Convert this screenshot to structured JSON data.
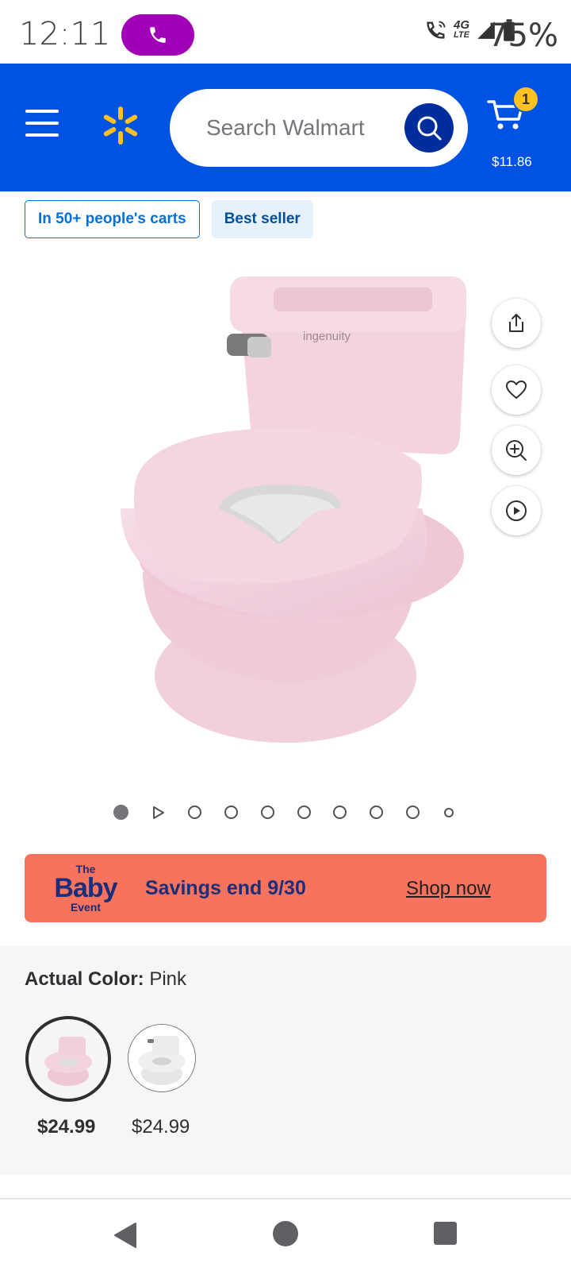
{
  "status_bar": {
    "time": "12:11",
    "network": "4G",
    "network_sub": "LTE",
    "battery": "75%"
  },
  "header": {
    "search_placeholder": "Search Walmart",
    "cart_count": "1",
    "cart_total": "$11.86",
    "brand_color": "#0053e2"
  },
  "badges": {
    "carts": "In 50+ people's carts",
    "best_seller": "Best seller"
  },
  "product": {
    "image_brand_text": "ingenuity",
    "carousel_count": 10,
    "carousel_active_index": 0
  },
  "promo": {
    "logo_line1": "The",
    "logo_line2": "Baby",
    "logo_line3": "Event",
    "text": "Savings end 9/30",
    "link": "Shop now"
  },
  "variants": {
    "label": "Actual Color:",
    "selected": "Pink",
    "options": [
      {
        "name": "Pink",
        "price": "$24.99"
      },
      {
        "name": "White",
        "price": "$24.99"
      }
    ]
  }
}
